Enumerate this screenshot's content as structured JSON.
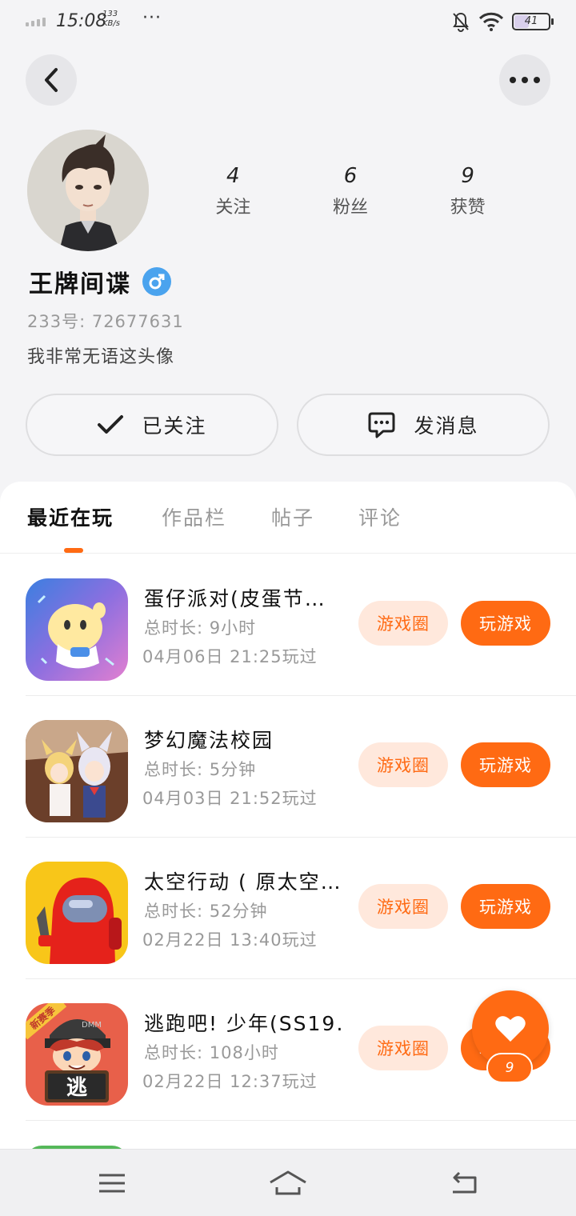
{
  "status_bar": {
    "time": "15:08",
    "net_speed_value": "133",
    "net_speed_unit": "KB/s",
    "more": "···",
    "battery": "41"
  },
  "profile": {
    "stats": [
      {
        "value": "4",
        "label": "关注"
      },
      {
        "value": "6",
        "label": "粉丝"
      },
      {
        "value": "9",
        "label": "获赞"
      }
    ],
    "username": "王牌间谍",
    "gender_symbol": "♂",
    "account_id": "233号: 72677631",
    "bio": "我非常无语这头像"
  },
  "actions": {
    "follow_label": "已关注",
    "message_label": "发消息"
  },
  "tabs": [
    {
      "label": "最近在玩",
      "active": true
    },
    {
      "label": "作品栏",
      "active": false
    },
    {
      "label": "帖子",
      "active": false
    },
    {
      "label": "评论",
      "active": false
    }
  ],
  "games": [
    {
      "title": "蛋仔派对(皮蛋节…",
      "duration": "总时长: 9小时",
      "last_played": "04月06日 21:25玩过",
      "circle_label": "游戏圈",
      "play_label": "玩游戏"
    },
    {
      "title": "梦幻魔法校园",
      "duration": "总时长: 5分钟",
      "last_played": "04月03日 21:52玩过",
      "circle_label": "游戏圈",
      "play_label": "玩游戏"
    },
    {
      "title": "太空行动 ( 原太空…",
      "duration": "总时长: 52分钟",
      "last_played": "02月22日 13:40玩过",
      "circle_label": "游戏圈",
      "play_label": "玩游戏"
    },
    {
      "title": "逃跑吧! 少年(SS19…",
      "duration": "总时长: 108小时",
      "last_played": "02月22日 12:37玩过",
      "circle_label": "游戏圈",
      "play_label": "玩游戏",
      "icon_badge": "新赛季",
      "icon_char": "逃",
      "icon_brand": "DMM"
    }
  ],
  "like_fab": {
    "count": "9"
  },
  "colors": {
    "accent": "#ff6a13",
    "accent_light": "#ffe8dc",
    "gender_blue": "#4aa3ee"
  }
}
